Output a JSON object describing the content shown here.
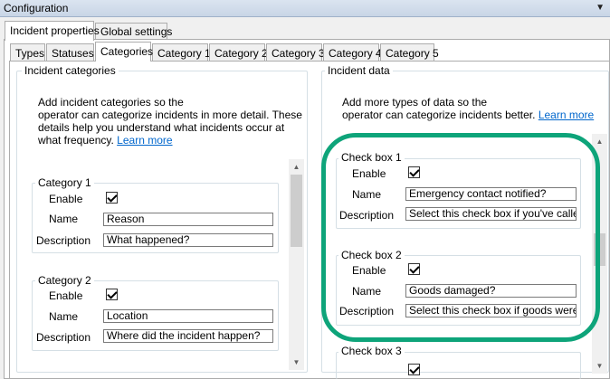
{
  "window": {
    "title": "Configuration"
  },
  "main_tabs": [
    {
      "label": "Incident properties",
      "active": true
    },
    {
      "label": "Global settings",
      "active": false
    }
  ],
  "sub_tabs": [
    {
      "label": "Types"
    },
    {
      "label": "Statuses"
    },
    {
      "label": "Categories"
    },
    {
      "label": "Category 1"
    },
    {
      "label": "Category 2"
    },
    {
      "label": "Category 3"
    },
    {
      "label": "Category 4"
    },
    {
      "label": "Category 5"
    }
  ],
  "left": {
    "heading": "Incident categories",
    "description_1": "Add incident categories so the",
    "description_2": "operator can categorize incidents in more detail. These",
    "description_3": "details help you understand what incidents occur at",
    "description_4": "what frequency.",
    "learn_more": "Learn more",
    "categories": [
      {
        "title": "Category 1",
        "enable_label": "Enable",
        "enabled": true,
        "name_label": "Name",
        "name_value": "Reason",
        "description_label": "Description",
        "description_value": "What happened?"
      },
      {
        "title": "Category 2",
        "enable_label": "Enable",
        "enabled": true,
        "name_label": "Name",
        "name_value": "Location",
        "description_label": "Description",
        "description_value": "Where did the incident happen?"
      }
    ]
  },
  "right": {
    "heading": "Incident data",
    "description_1": "Add more types of data so the",
    "description_2": "operator can categorize incidents better.",
    "learn_more": "Learn more",
    "checkboxes": [
      {
        "title": "Check box 1",
        "enable_label": "Enable",
        "enabled": true,
        "name_label": "Name",
        "name_value": "Emergency contact notified?",
        "description_label": "Description",
        "description_value": "Select this check box if you've called t"
      },
      {
        "title": "Check box 2",
        "enable_label": "Enable",
        "enabled": true,
        "name_label": "Name",
        "name_value": "Goods damaged?",
        "description_label": "Description",
        "description_value": "Select this check box if goods were da"
      },
      {
        "title": "Check box 3"
      }
    ]
  },
  "icons": {
    "dropdown": "chevron-down-icon",
    "scroll_up": "arrow-up-icon",
    "scroll_down": "arrow-down-icon"
  },
  "colors": {
    "highlight": "#0ea47a",
    "link": "#0066cc"
  }
}
